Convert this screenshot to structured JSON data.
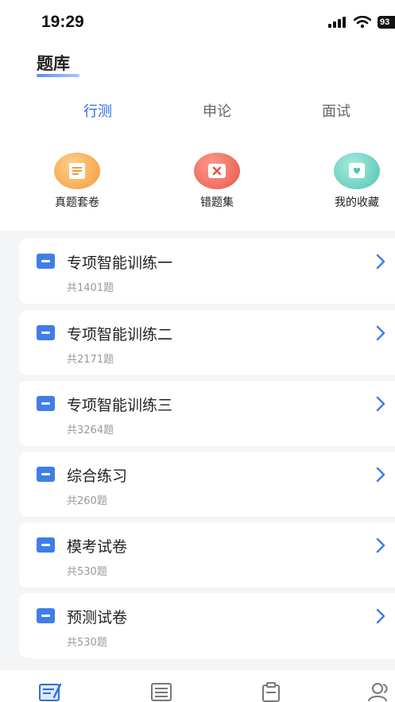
{
  "status_bar": {
    "time": "19:29",
    "battery": "93"
  },
  "header": {
    "title": "题库"
  },
  "tabs": [
    {
      "label": "行测",
      "active": true
    },
    {
      "label": "申论",
      "active": false
    },
    {
      "label": "面试",
      "active": false
    }
  ],
  "shortcuts": [
    {
      "label": "真题套卷",
      "icon": "exam-paper-icon",
      "color": "#f39a3c"
    },
    {
      "label": "错题集",
      "icon": "wrong-questions-icon",
      "color": "#e4574a"
    },
    {
      "label": "我的收藏",
      "icon": "favorites-icon",
      "color": "#4fc4b2"
    }
  ],
  "sections": [
    {
      "title": "专项智能训练一",
      "count": "共1401题"
    },
    {
      "title": "专项智能训练二",
      "count": "共2171题"
    },
    {
      "title": "专项智能训练三",
      "count": "共3264题"
    },
    {
      "title": "综合练习",
      "count": "共260题"
    },
    {
      "title": "模考试卷",
      "count": "共530题"
    },
    {
      "title": "预测试卷",
      "count": "共530题"
    }
  ],
  "bottom_nav": [
    {
      "icon": "question-bank-icon",
      "active": true
    },
    {
      "icon": "list-icon",
      "active": false
    },
    {
      "icon": "clipboard-icon",
      "active": false
    },
    {
      "icon": "profile-icon",
      "active": false
    }
  ],
  "colors": {
    "accent": "#2d6fe0",
    "section_icon": "#3f7ee8"
  }
}
